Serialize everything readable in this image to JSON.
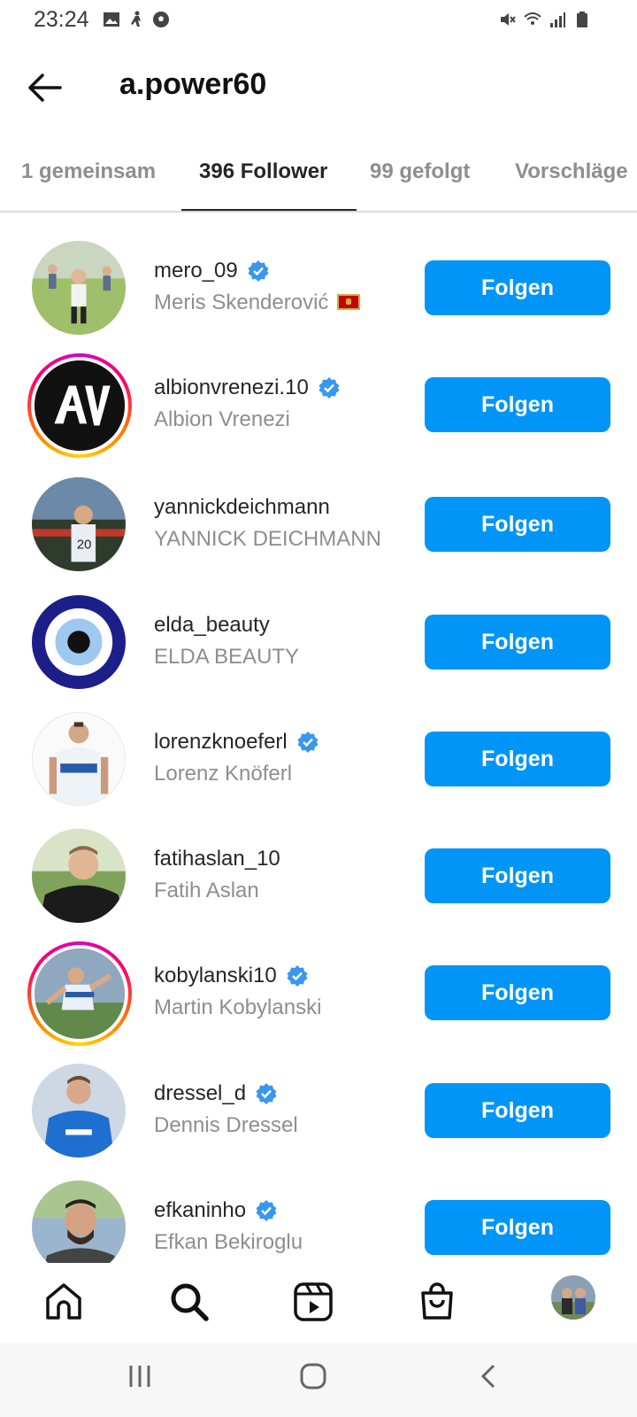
{
  "status_bar": {
    "time": "23:24",
    "left_icons": [
      "image-icon",
      "person-walk-icon",
      "soccer-ball-icon"
    ],
    "right_icons": [
      "mute-icon",
      "wifi-icon",
      "signal-icon",
      "battery-icon"
    ]
  },
  "header": {
    "title": "a.power60"
  },
  "tabs": [
    {
      "label": "1 gemeinsam",
      "active": false
    },
    {
      "label": "396 Follower",
      "active": true
    },
    {
      "label": "99 gefolgt",
      "active": false
    },
    {
      "label": "Vorschläge",
      "active": false
    }
  ],
  "follow_label": "Folgen",
  "followers": [
    {
      "username": "mero_09",
      "name": "Meris Skenderović",
      "verified": true,
      "flag": "montenegro",
      "story_ring": false
    },
    {
      "username": "albionvrenezi.10",
      "name": "Albion Vrenezi",
      "verified": true,
      "story_ring": true
    },
    {
      "username": "yannickdeichmann",
      "name": "YANNICK DEICHMANN",
      "verified": false,
      "story_ring": false
    },
    {
      "username": "elda_beauty",
      "name": "ELDA BEAUTY",
      "verified": false,
      "story_ring": false
    },
    {
      "username": "lorenzknoeferl",
      "name": "Lorenz Knöferl",
      "verified": true,
      "story_ring": false
    },
    {
      "username": "fatihaslan_10",
      "name": "Fatih Aslan",
      "verified": false,
      "story_ring": false
    },
    {
      "username": "kobylanski10",
      "name": "Martin Kobylanski",
      "verified": true,
      "story_ring": true
    },
    {
      "username": "dressel_d",
      "name": "Dennis Dressel",
      "verified": true,
      "story_ring": false
    },
    {
      "username": "efkaninho",
      "name": "Efkan Bekiroglu",
      "verified": true,
      "story_ring": false
    }
  ],
  "bottom_nav": [
    "home-icon",
    "search-icon",
    "reels-icon",
    "shop-icon",
    "profile-avatar"
  ],
  "colors": {
    "accent": "#0095f6",
    "text": "#262626",
    "muted": "#8e8e8e"
  }
}
